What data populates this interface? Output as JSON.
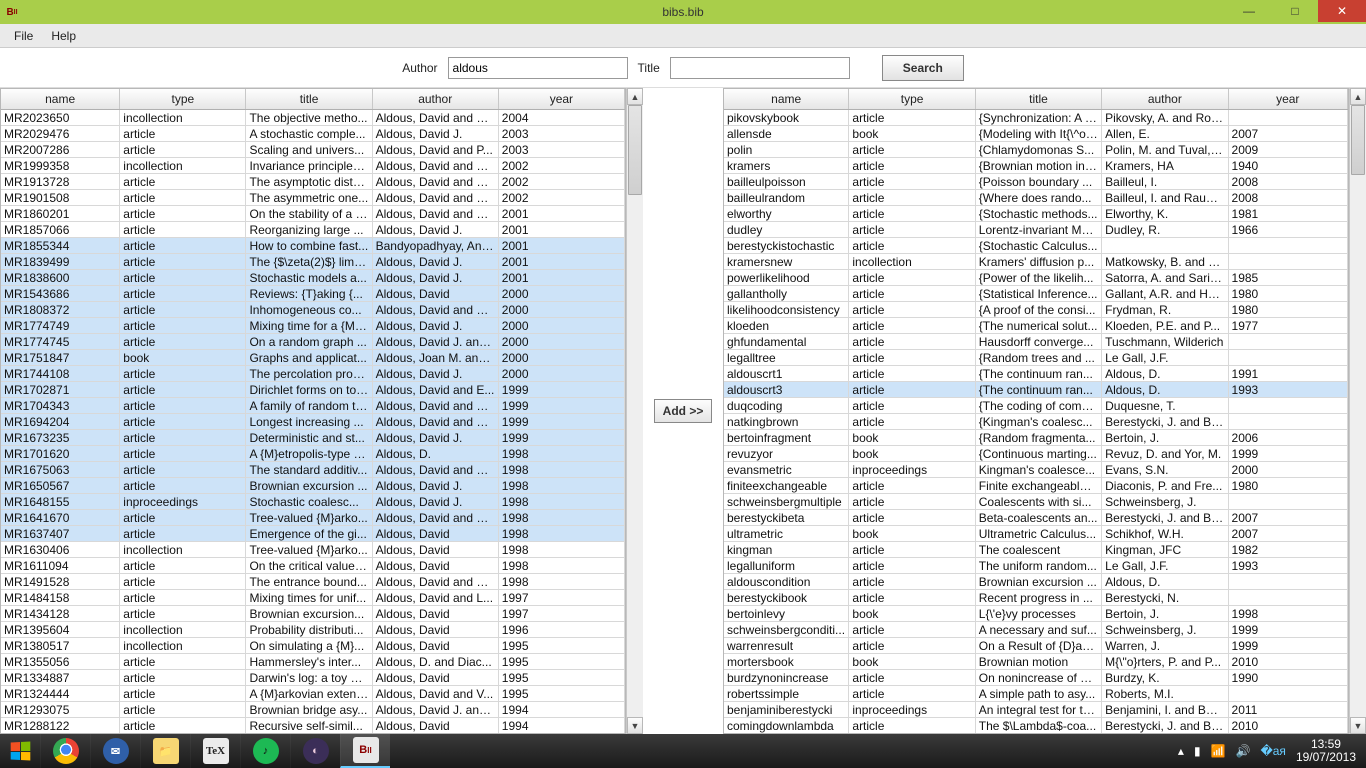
{
  "window": {
    "title": "bibs.bib"
  },
  "menu": {
    "file": "File",
    "help": "Help"
  },
  "search": {
    "author_label": "Author",
    "author_value": "aldous",
    "title_label": "Title",
    "title_value": "",
    "button": "Search"
  },
  "add_button": "Add >>",
  "columns": [
    "name",
    "type",
    "title",
    "author",
    "year"
  ],
  "left_rows": [
    {
      "sel": false,
      "c": [
        "MR2023650",
        "incollection",
        "The objective metho...",
        "Aldous, David and St...",
        "2004"
      ]
    },
    {
      "sel": false,
      "c": [
        "MR2029476",
        "article",
        "A stochastic comple...",
        "Aldous, David J.",
        "2003"
      ]
    },
    {
      "sel": false,
      "c": [
        "MR2007286",
        "article",
        "Scaling and univers...",
        "Aldous, David and P...",
        "2003"
      ]
    },
    {
      "sel": false,
      "c": [
        "MR1999358",
        "incollection",
        "Invariance principles...",
        "Aldous, David and Pi...",
        "2002"
      ]
    },
    {
      "sel": false,
      "c": [
        "MR1913728",
        "article",
        "The asymptotic distri...",
        "Aldous, David and Pi...",
        "2002"
      ]
    },
    {
      "sel": false,
      "c": [
        "MR1901508",
        "article",
        "The asymmetric one...",
        "Aldous, David and Pi...",
        "2002"
      ]
    },
    {
      "sel": false,
      "c": [
        "MR1860201",
        "article",
        "On the stability of a b...",
        "Aldous, David and Mi...",
        "2001"
      ]
    },
    {
      "sel": false,
      "c": [
        "MR1857066",
        "article",
        "Reorganizing large ...",
        "Aldous, David J.",
        "2001"
      ]
    },
    {
      "sel": true,
      "c": [
        "MR1855344",
        "article",
        "How to combine fast...",
        "Bandyopadhyay, Ant...",
        "2001"
      ]
    },
    {
      "sel": true,
      "c": [
        "MR1839499",
        "article",
        "The {$\\zeta(2)$} limit...",
        "Aldous, David J.",
        "2001"
      ]
    },
    {
      "sel": true,
      "c": [
        "MR1838600",
        "article",
        "Stochastic models a...",
        "Aldous, David J.",
        "2001"
      ]
    },
    {
      "sel": true,
      "c": [
        "MR1543686",
        "article",
        "Reviews: {T}aking {...",
        "Aldous, David",
        "2000"
      ]
    },
    {
      "sel": true,
      "c": [
        "MR1808372",
        "article",
        "Inhomogeneous co...",
        "Aldous, David and Pi...",
        "2000"
      ]
    },
    {
      "sel": true,
      "c": [
        "MR1774749",
        "article",
        "Mixing time for a {M}...",
        "Aldous, David J.",
        "2000"
      ]
    },
    {
      "sel": true,
      "c": [
        "MR1774745",
        "article",
        "On a random graph ...",
        "Aldous, David J. and ...",
        "2000"
      ]
    },
    {
      "sel": true,
      "c": [
        "MR1751847",
        "book",
        "Graphs and applicat...",
        "Aldous, Joan M. and ...",
        "2000"
      ]
    },
    {
      "sel": true,
      "c": [
        "MR1744108",
        "article",
        "The percolation proc...",
        "Aldous, David J.",
        "2000"
      ]
    },
    {
      "sel": true,
      "c": [
        "MR1702871",
        "article",
        "Dirichlet forms on tot...",
        "Aldous, David and E...",
        "1999"
      ]
    },
    {
      "sel": true,
      "c": [
        "MR1704343",
        "article",
        "A family of random tr...",
        "Aldous, David and Pi...",
        "1999"
      ]
    },
    {
      "sel": true,
      "c": [
        "MR1694204",
        "article",
        "Longest increasing ...",
        "Aldous, David and Di...",
        "1999"
      ]
    },
    {
      "sel": true,
      "c": [
        "MR1673235",
        "article",
        "Deterministic and st...",
        "Aldous, David J.",
        "1999"
      ]
    },
    {
      "sel": true,
      "c": [
        "MR1701620",
        "article",
        "A {M}etropolis-type o...",
        "Aldous, D.",
        "1998"
      ]
    },
    {
      "sel": true,
      "c": [
        "MR1675063",
        "article",
        "The standard additiv...",
        "Aldous, David and Pi...",
        "1998"
      ]
    },
    {
      "sel": true,
      "c": [
        "MR1650567",
        "article",
        "Brownian excursion ...",
        "Aldous, David J.",
        "1998"
      ]
    },
    {
      "sel": true,
      "c": [
        "MR1648155",
        "inproceedings",
        "Stochastic coalesc...",
        "Aldous, David J.",
        "1998"
      ]
    },
    {
      "sel": true,
      "c": [
        "MR1641670",
        "article",
        "Tree-valued {M}arko...",
        "Aldous, David and Pi...",
        "1998"
      ]
    },
    {
      "sel": true,
      "c": [
        "MR1637407",
        "article",
        "Emergence of the gi...",
        "Aldous, David",
        "1998"
      ]
    },
    {
      "sel": false,
      "c": [
        "MR1630406",
        "incollection",
        "Tree-valued {M}arko...",
        "Aldous, David",
        "1998"
      ]
    },
    {
      "sel": false,
      "c": [
        "MR1611094",
        "article",
        "On the critical value f...",
        "Aldous, David",
        "1998"
      ]
    },
    {
      "sel": false,
      "c": [
        "MR1491528",
        "article",
        "The entrance bound...",
        "Aldous, David and Li...",
        "1998"
      ]
    },
    {
      "sel": false,
      "c": [
        "MR1484158",
        "article",
        "Mixing times for unif...",
        "Aldous, David and L...",
        "1997"
      ]
    },
    {
      "sel": false,
      "c": [
        "MR1434128",
        "article",
        "Brownian excursion...",
        "Aldous, David",
        "1997"
      ]
    },
    {
      "sel": false,
      "c": [
        "MR1395604",
        "incollection",
        "Probability distributi...",
        "Aldous, David",
        "1996"
      ]
    },
    {
      "sel": false,
      "c": [
        "MR1380517",
        "incollection",
        "On simulating a {M}...",
        "Aldous, David",
        "1995"
      ]
    },
    {
      "sel": false,
      "c": [
        "MR1355056",
        "article",
        "Hammersley's inter...",
        "Aldous, D. and Diac...",
        "1995"
      ]
    },
    {
      "sel": false,
      "c": [
        "MR1334887",
        "article",
        "Darwin's log: a toy m...",
        "Aldous, David",
        "1995"
      ]
    },
    {
      "sel": false,
      "c": [
        "MR1324444",
        "article",
        "A {M}arkovian extens...",
        "Aldous, David and V...",
        "1995"
      ]
    },
    {
      "sel": false,
      "c": [
        "MR1293075",
        "article",
        "Brownian bridge asy...",
        "Aldous, David J. and ...",
        "1994"
      ]
    },
    {
      "sel": false,
      "c": [
        "MR1288122",
        "article",
        "Recursive self-simil...",
        "Aldous, David",
        "1994"
      ]
    }
  ],
  "right_rows": [
    {
      "sel": false,
      "c": [
        "pikovskybook",
        "article",
        "{Synchronization: A u...",
        "Pikovsky, A. and Ros...",
        ""
      ]
    },
    {
      "sel": false,
      "c": [
        "allensde",
        "book",
        "{Modeling with It{\\^o}...",
        "Allen, E.",
        "2007"
      ]
    },
    {
      "sel": false,
      "c": [
        "polin",
        "article",
        "{Chlamydomonas S...",
        "Polin, M. and Tuval, I...",
        "2009"
      ]
    },
    {
      "sel": false,
      "c": [
        "kramers",
        "article",
        "{Brownian motion in ...",
        "Kramers, HA",
        "1940"
      ]
    },
    {
      "sel": false,
      "c": [
        "bailleulpoisson",
        "article",
        "{Poisson boundary ...",
        "Bailleul, I.",
        "2008"
      ]
    },
    {
      "sel": false,
      "c": [
        "bailleulrandom",
        "article",
        "{Where does rando...",
        "Bailleul, I. and Raugi...",
        "2008"
      ]
    },
    {
      "sel": false,
      "c": [
        "elworthy",
        "article",
        "{Stochastic methods...",
        "Elworthy, K.",
        "1981"
      ]
    },
    {
      "sel": false,
      "c": [
        "dudley",
        "article",
        "Lorentz-invariant Mar...",
        "Dudley, R.",
        "1966"
      ]
    },
    {
      "sel": false,
      "c": [
        "berestyckistochastic",
        "article",
        "{Stochastic Calculus...",
        "",
        ""
      ]
    },
    {
      "sel": false,
      "c": [
        "kramersnew",
        "incollection",
        "Kramers' diffusion p...",
        "Matkowsky, B. and S...",
        ""
      ]
    },
    {
      "sel": false,
      "c": [
        "powerlikelihood",
        "article",
        "{Power of the likelih...",
        "Satorra, A. and Saris...",
        "1985"
      ]
    },
    {
      "sel": false,
      "c": [
        "gallantholly",
        "article",
        "{Statistical Inference...",
        "Gallant, A.R. and Hol...",
        "1980"
      ]
    },
    {
      "sel": false,
      "c": [
        "likelihoodconsistency",
        "article",
        "{A proof of the consi...",
        "Frydman, R.",
        "1980"
      ]
    },
    {
      "sel": false,
      "c": [
        "kloeden",
        "article",
        "{The numerical solut...",
        "Kloeden, P.E. and P...",
        "1977"
      ]
    },
    {
      "sel": false,
      "c": [
        "ghfundamental",
        "article",
        "Hausdorff converge...",
        "Tuschmann, Wilderich",
        ""
      ]
    },
    {
      "sel": false,
      "c": [
        "legalltree",
        "article",
        "{Random trees and ...",
        "Le Gall, J.F.",
        ""
      ]
    },
    {
      "sel": false,
      "c": [
        "aldouscrt1",
        "article",
        "{The continuum ran...",
        "Aldous, D.",
        "1991"
      ]
    },
    {
      "sel": true,
      "c": [
        "aldouscrt3",
        "article",
        "{The continuum ran...",
        "Aldous, D.",
        "1993"
      ]
    },
    {
      "sel": false,
      "c": [
        "duqcoding",
        "article",
        "{The coding of comp...",
        "Duquesne, T.",
        ""
      ]
    },
    {
      "sel": false,
      "c": [
        "natkingbrown",
        "article",
        "{Kingman's coalesc...",
        "Berestycki, J. and Be...",
        ""
      ]
    },
    {
      "sel": false,
      "c": [
        "bertoinfragment",
        "book",
        "{Random fragmenta...",
        "Bertoin, J.",
        "2006"
      ]
    },
    {
      "sel": false,
      "c": [
        "revuzyor",
        "book",
        "{Continuous marting...",
        "Revuz, D. and Yor, M.",
        "1999"
      ]
    },
    {
      "sel": false,
      "c": [
        "evansmetric",
        "inproceedings",
        "Kingman's coalesce...",
        "Evans, S.N.",
        "2000"
      ]
    },
    {
      "sel": false,
      "c": [
        "finiteexchangeable",
        "article",
        "Finite exchangeable ...",
        "Diaconis, P. and Fre...",
        "1980"
      ]
    },
    {
      "sel": false,
      "c": [
        "schweinsbergmultiple",
        "article",
        "Coalescents with si...",
        "Schweinsberg, J.",
        ""
      ]
    },
    {
      "sel": false,
      "c": [
        "berestyckibeta",
        "article",
        "Beta-coalescents an...",
        "Berestycki, J. and Be...",
        "2007"
      ]
    },
    {
      "sel": false,
      "c": [
        "ultrametric",
        "book",
        "Ultrametric Calculus...",
        "Schikhof, W.H.",
        "2007"
      ]
    },
    {
      "sel": false,
      "c": [
        "kingman",
        "article",
        "The coalescent",
        "Kingman, JFC",
        "1982"
      ]
    },
    {
      "sel": false,
      "c": [
        "legalluniform",
        "article",
        "The uniform random...",
        "Le Gall, J.F.",
        "1993"
      ]
    },
    {
      "sel": false,
      "c": [
        "aldouscondition",
        "article",
        "Brownian excursion ...",
        "Aldous, D.",
        ""
      ]
    },
    {
      "sel": false,
      "c": [
        "berestyckibook",
        "article",
        "Recent progress in ...",
        "Berestycki, N.",
        ""
      ]
    },
    {
      "sel": false,
      "c": [
        "bertoinlevy",
        "book",
        "L{\\'e}vy processes",
        "Bertoin, J.",
        "1998"
      ]
    },
    {
      "sel": false,
      "c": [
        "schweinsbergconditi...",
        "article",
        "A necessary and suf...",
        "Schweinsberg, J.",
        "1999"
      ]
    },
    {
      "sel": false,
      "c": [
        "warrenresult",
        "article",
        "On a Result of {D}avi...",
        "Warren, J.",
        "1999"
      ]
    },
    {
      "sel": false,
      "c": [
        "mortersbook",
        "book",
        "Brownian motion",
        "M{\\\"o}rters, P. and P...",
        "2010"
      ]
    },
    {
      "sel": false,
      "c": [
        "burdzynonincrease",
        "article",
        "On nonincrease of B...",
        "Burdzy, K.",
        "1990"
      ]
    },
    {
      "sel": false,
      "c": [
        "robertssimple",
        "article",
        "A simple path to asy...",
        "Roberts, M.I.",
        ""
      ]
    },
    {
      "sel": false,
      "c": [
        "benjaminiberestycki",
        "inproceedings",
        "An integral test for th...",
        "Benjamini, I. and Ber...",
        "2011"
      ]
    },
    {
      "sel": false,
      "c": [
        "comingdownlambda",
        "article",
        "The $\\Lambda$-coa...",
        "Berestycki, J. and Be...",
        "2010"
      ]
    }
  ],
  "tray": {
    "time": "13:59",
    "date": "19/07/2013"
  }
}
